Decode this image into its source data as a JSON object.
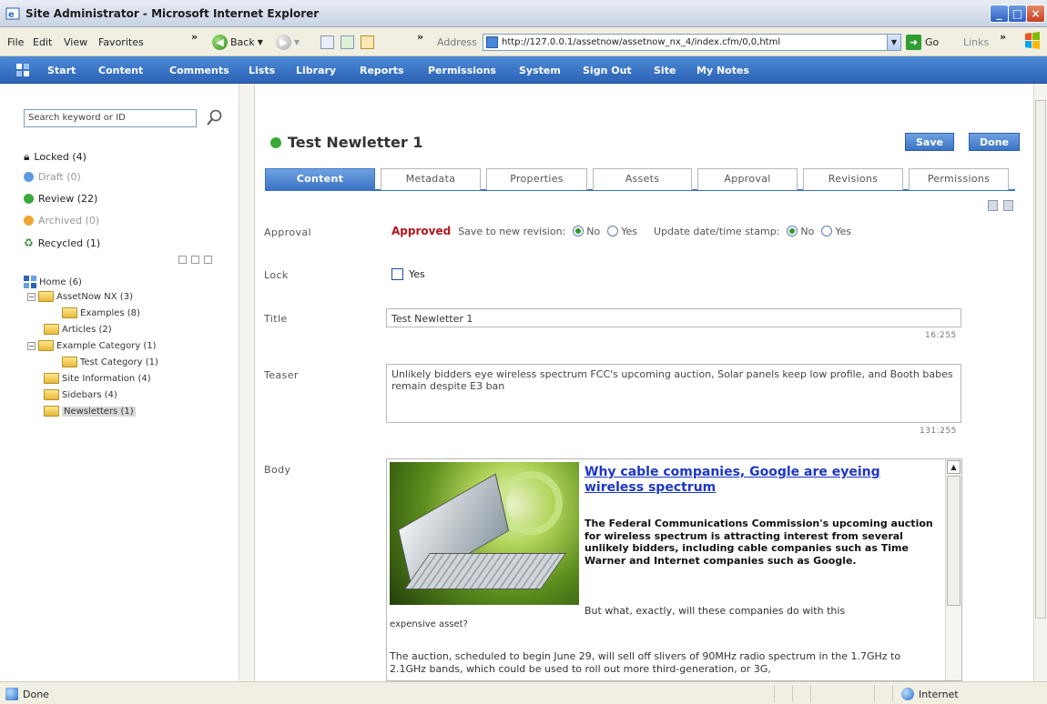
{
  "window": {
    "title": "Site Administrator - Microsoft Internet Explorer"
  },
  "browser": {
    "menu": [
      "File",
      "Edit",
      "View",
      "Favorites"
    ],
    "back_label": "Back",
    "address_label": "Address",
    "url": "http://127.0.0.1/assetnow/assetnow_nx_4/index.cfm/0,0,html",
    "go_label": "Go",
    "links_label": "Links"
  },
  "appnav": {
    "items": [
      "Start",
      "Content",
      "Comments",
      "Lists",
      "Library",
      "Reports",
      "Permissions",
      "System",
      "Sign Out",
      "Site",
      "My Notes"
    ]
  },
  "sidebar": {
    "search_placeholder": "Search keyword or ID",
    "statuses": [
      {
        "label": "Locked (4)",
        "muted": false
      },
      {
        "label": "Draft (0)",
        "muted": true
      },
      {
        "label": "Review (22)",
        "muted": false
      },
      {
        "label": "Archived (0)",
        "muted": true
      },
      {
        "label": "Recycled (1)",
        "muted": false
      }
    ],
    "tree": [
      {
        "label": "Home (6)"
      },
      {
        "label": "AssetNow NX (3)"
      },
      {
        "label": "Examples (8)"
      },
      {
        "label": "Articles (2)"
      },
      {
        "label": "Example Category (1)"
      },
      {
        "label": "Test Category (1)"
      },
      {
        "label": "Site Information (4)"
      },
      {
        "label": "Sidebars (4)"
      },
      {
        "label": "Newsletters (1)"
      }
    ]
  },
  "page": {
    "title": "Test Newletter 1",
    "save_label": "Save",
    "done_label": "Done",
    "tabs": [
      "Content",
      "Metadata",
      "Properties",
      "Assets",
      "Approval",
      "Revisions",
      "Permissions"
    ],
    "active_tab": "Content"
  },
  "form": {
    "approval_label": "Approval",
    "approval_status": "Approved",
    "save_revision_label": "Save to new revision:",
    "update_stamp_label": "Update date/time stamp:",
    "opt_no": "No",
    "opt_yes": "Yes",
    "lock_label": "Lock",
    "lock_option": "Yes",
    "title_label": "Title",
    "title_value": "Test Newletter 1",
    "title_counter": "16:255",
    "teaser_label": "Teaser",
    "teaser_value": "Unlikely bidders eye wireless spectrum FCC's upcoming auction, Solar panels keep low profile, and Booth babes remain despite E3 ban",
    "teaser_counter": "131:255",
    "body_label": "Body"
  },
  "body": {
    "headline": "Why cable companies, Google are eyeing wireless spectrum",
    "lead": "The Federal Communications Commission's upcoming auction for wireless spectrum is attracting interest from several unlikely bidders, including cable companies such as Time Warner and Internet companies such as Google.",
    "p1a": "But what, exactly, will these companies do with this",
    "p1b": "expensive asset?",
    "p2": "The auction, scheduled to begin June 29, will sell off slivers of 90MHz radio spectrum in the 1.7GHz to 2.1GHz bands, which could be used to roll out more third-generation, or 3G,"
  },
  "statusbar": {
    "left": "Done",
    "zone": "Internet"
  }
}
